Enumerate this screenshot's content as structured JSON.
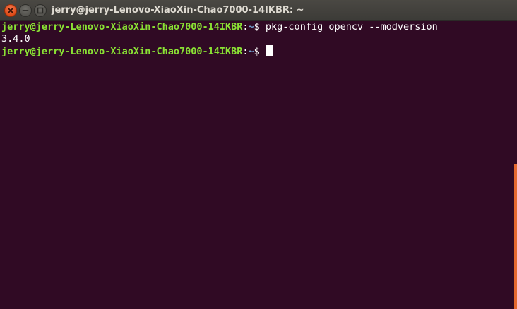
{
  "window": {
    "title": "jerry@jerry-Lenovo-XiaoXin-Chao7000-14IKBR: ~",
    "controls": {
      "close_icon": "close-icon",
      "minimize_icon": "minimize-icon",
      "maximize_icon": "maximize-icon"
    }
  },
  "terminal": {
    "lines": [
      {
        "user_host": "jerry@jerry-Lenovo-XiaoXin-Chao7000-14IKBR",
        "separator": ":",
        "path": "~",
        "symbol": "$ ",
        "command": "pkg-config opencv --modversion"
      },
      {
        "output": "3.4.0"
      },
      {
        "user_host": "jerry@jerry-Lenovo-XiaoXin-Chao7000-14IKBR",
        "separator": ":",
        "path": "~",
        "symbol": "$ ",
        "command": ""
      }
    ]
  },
  "colors": {
    "background": "#300a24",
    "prompt_user": "#8ae234",
    "prompt_path": "#729fcf",
    "text": "#ffffff",
    "scrollbar": "#e4692f"
  }
}
